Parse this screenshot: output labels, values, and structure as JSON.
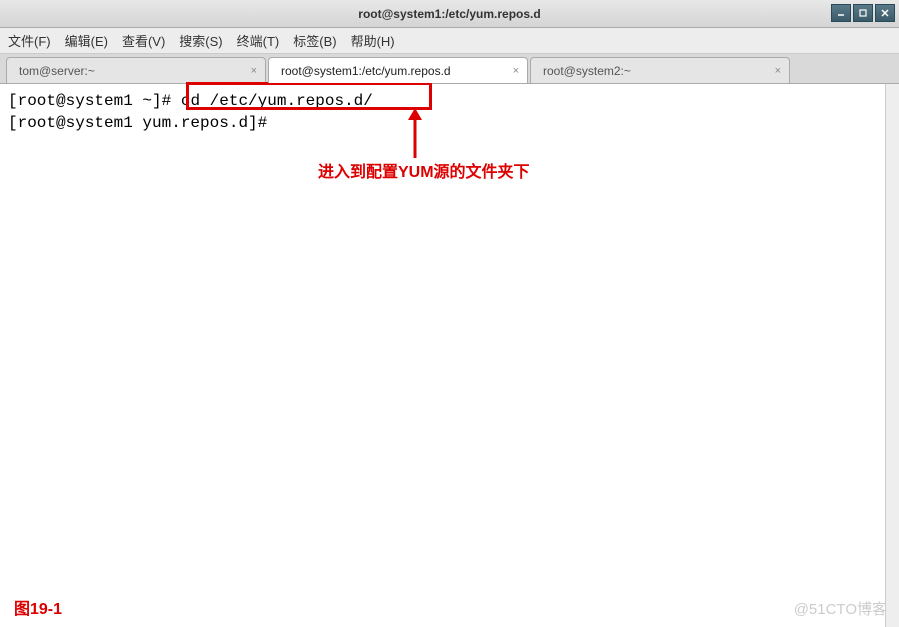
{
  "window": {
    "title": "root@system1:/etc/yum.repos.d"
  },
  "menu": {
    "file": "文件(F)",
    "edit": "编辑(E)",
    "view": "查看(V)",
    "search": "搜索(S)",
    "terminal": "终端(T)",
    "tabs": "标签(B)",
    "help": "帮助(H)"
  },
  "tabs": {
    "0": {
      "label": "tom@server:~"
    },
    "1": {
      "label": "root@system1:/etc/yum.repos.d"
    },
    "2": {
      "label": "root@system2:~"
    }
  },
  "terminal": {
    "line1_prompt": "[root@system1 ~]#",
    "line1_cmd": "cd /etc/yum.repos.d/",
    "line2": "[root@system1 yum.repos.d]#"
  },
  "annotation": {
    "text": "进入到配置YUM源的文件夹下"
  },
  "figure": {
    "label": "图19-1"
  },
  "watermark": {
    "text": "@51CTO博客"
  }
}
